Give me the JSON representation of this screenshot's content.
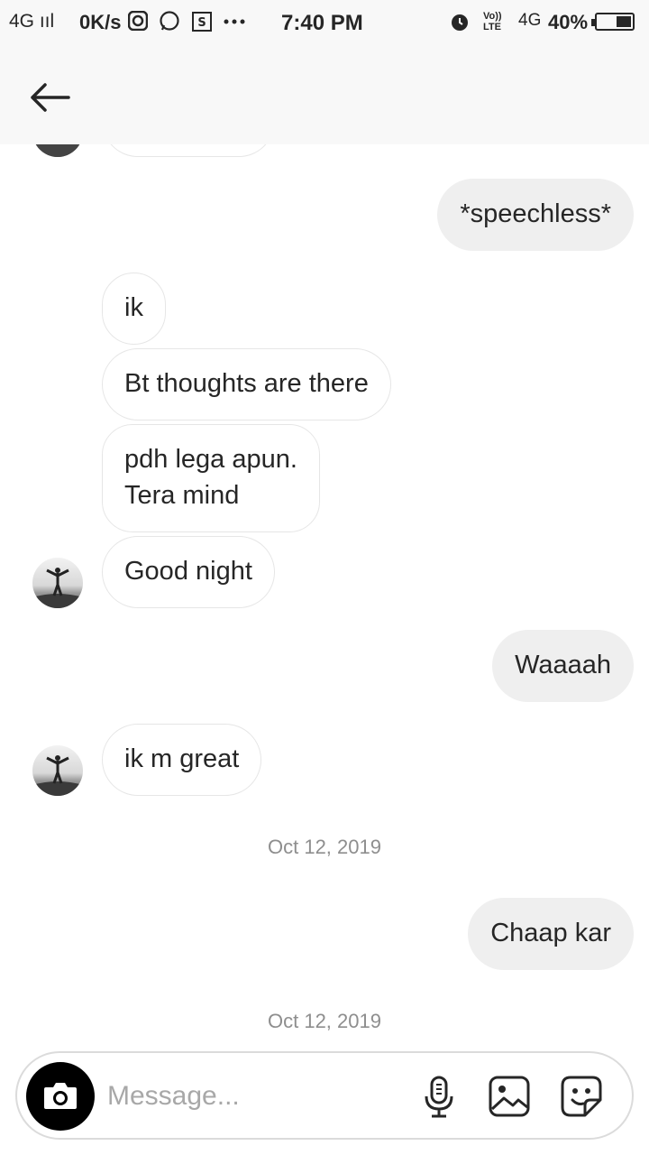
{
  "status_bar": {
    "network": "4G ııl",
    "speed": "0K/s",
    "time": "7:40 PM",
    "volte": "Vo)) LTE",
    "signal_4g": "4G",
    "battery": "40%"
  },
  "messages": [
    {
      "text": "*speechless*",
      "side": "out"
    },
    {
      "text": "ik",
      "side": "in"
    },
    {
      "text": "Bt thoughts are there",
      "side": "in"
    },
    {
      "text": "pdh lega apun.",
      "text2": "Tera mind",
      "side": "in"
    },
    {
      "text": "Good night",
      "side": "in"
    },
    {
      "text": "Waaaah",
      "side": "out"
    },
    {
      "text": "ik m great",
      "side": "in"
    },
    {
      "text": "Chaap kar",
      "side": "out"
    }
  ],
  "dates": [
    "Oct 12, 2019",
    "Oct 12, 2019"
  ],
  "composer": {
    "placeholder": "Message..."
  },
  "icons": {
    "back": "arrow-left-icon",
    "camera": "camera-icon",
    "mic": "microphone-icon",
    "gallery": "image-icon",
    "sticker": "sticker-icon"
  }
}
